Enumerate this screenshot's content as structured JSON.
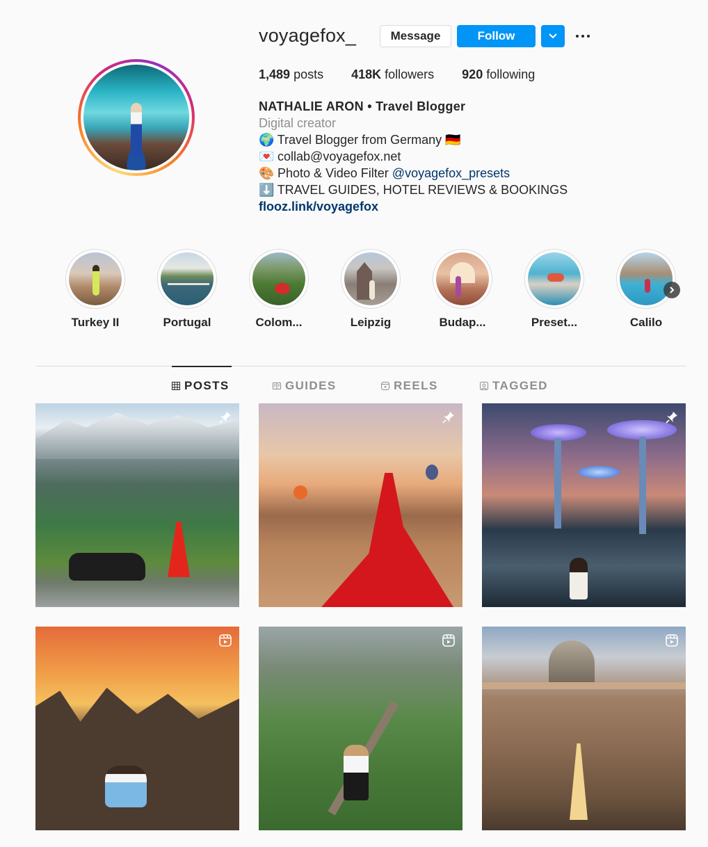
{
  "profile": {
    "username": "voyagefox_",
    "message_label": "Message",
    "follow_label": "Follow",
    "stats": {
      "posts_count": "1,489",
      "posts_label": "posts",
      "followers_count": "418K",
      "followers_label": "followers",
      "following_count": "920",
      "following_label": "following"
    },
    "bio": {
      "full_name": "NATHALIE ARON • Travel Blogger",
      "category": "Digital creator",
      "line1": "Travel Blogger from Germany",
      "line1_emoji_start": "🌍",
      "line1_emoji_end": "🇩🇪",
      "line2_emoji": "💌",
      "line2": "collab@voyagefox.net",
      "line3_emoji": "🎨",
      "line3_prefix": "Photo & Video Filter",
      "line3_mention": "@voyagefox_presets",
      "line4_emoji": "⬇️",
      "line4": "TRAVEL GUIDES, HOTEL REVIEWS & BOOKINGS",
      "website": "flooz.link/voyagefox"
    }
  },
  "highlights": [
    {
      "label": "Turkey II"
    },
    {
      "label": "Portugal"
    },
    {
      "label": "Colom..."
    },
    {
      "label": "Leipzig"
    },
    {
      "label": "Budap..."
    },
    {
      "label": "Preset..."
    },
    {
      "label": "Calilo"
    }
  ],
  "tabs": [
    {
      "label": "POSTS",
      "icon": "grid-icon",
      "active": true
    },
    {
      "label": "GUIDES",
      "icon": "guides-icon",
      "active": false
    },
    {
      "label": "REELS",
      "icon": "reels-icon",
      "active": false
    },
    {
      "label": "TAGGED",
      "icon": "tagged-icon",
      "active": false
    }
  ],
  "posts": [
    {
      "badge": "pin-icon"
    },
    {
      "badge": "pin-icon"
    },
    {
      "badge": "pin-icon"
    },
    {
      "badge": "reels-icon"
    },
    {
      "badge": "reels-icon"
    },
    {
      "badge": "reels-icon"
    }
  ],
  "colors": {
    "accent": "#0095f6",
    "link": "#00376b",
    "text": "#262626",
    "muted": "#8e8e8e",
    "border": "#dbdbdb",
    "background": "#fafafa"
  }
}
